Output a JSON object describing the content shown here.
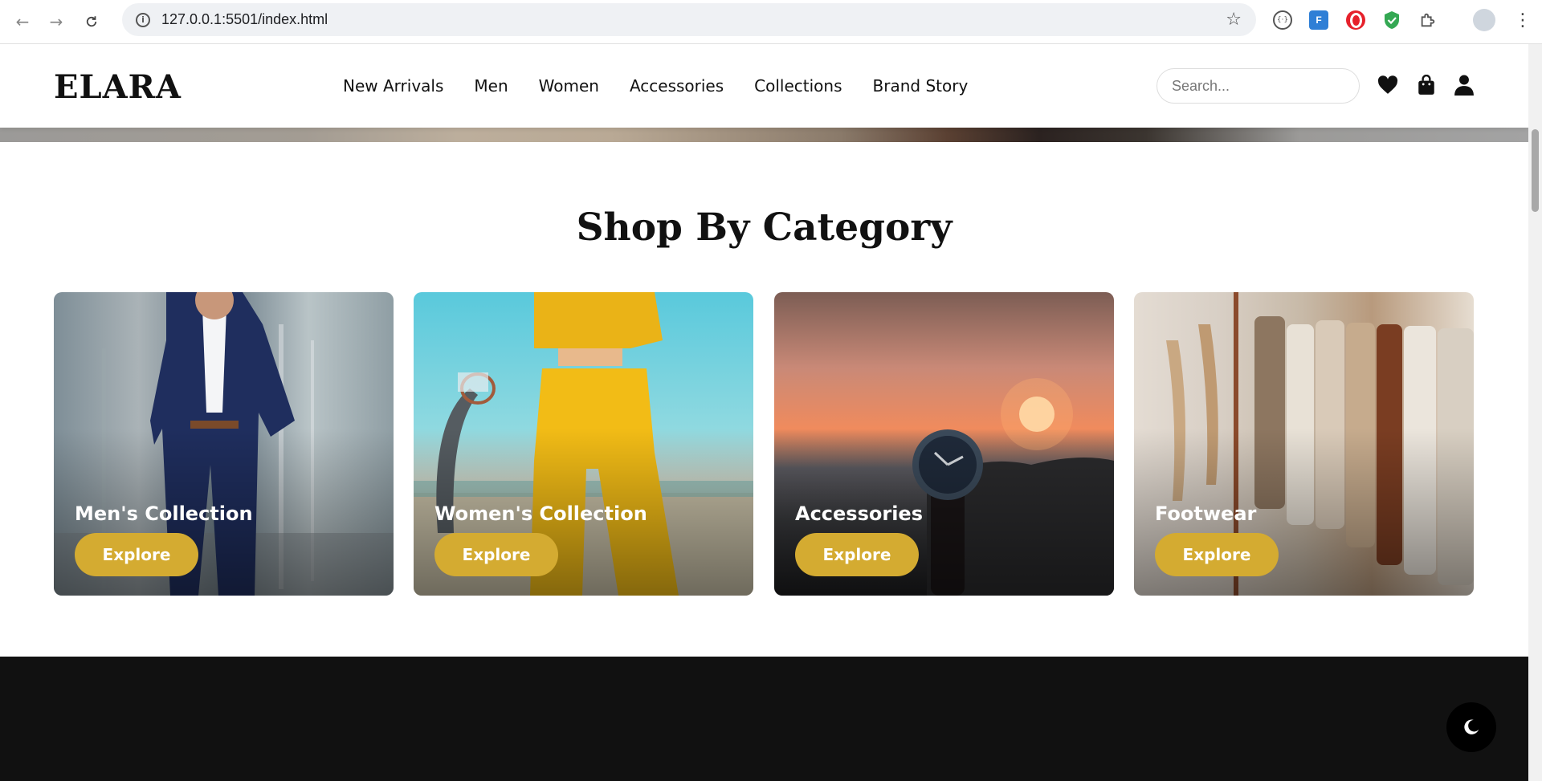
{
  "browser": {
    "url": "127.0.0.1:5501/index.html",
    "ext2_label": "F"
  },
  "header": {
    "logo": "ELARA",
    "nav": [
      "New Arrivals",
      "Men",
      "Women",
      "Accessories",
      "Collections",
      "Brand Story"
    ],
    "search_placeholder": "Search..."
  },
  "section": {
    "title": "Shop By Category"
  },
  "categories": [
    {
      "title": "Men's Collection",
      "button": "Explore"
    },
    {
      "title": "Women's Collection",
      "button": "Explore"
    },
    {
      "title": "Accessories",
      "button": "Explore"
    },
    {
      "title": "Footwear",
      "button": "Explore"
    }
  ],
  "colors": {
    "accent": "#d4ab31",
    "dark": "#111111"
  }
}
